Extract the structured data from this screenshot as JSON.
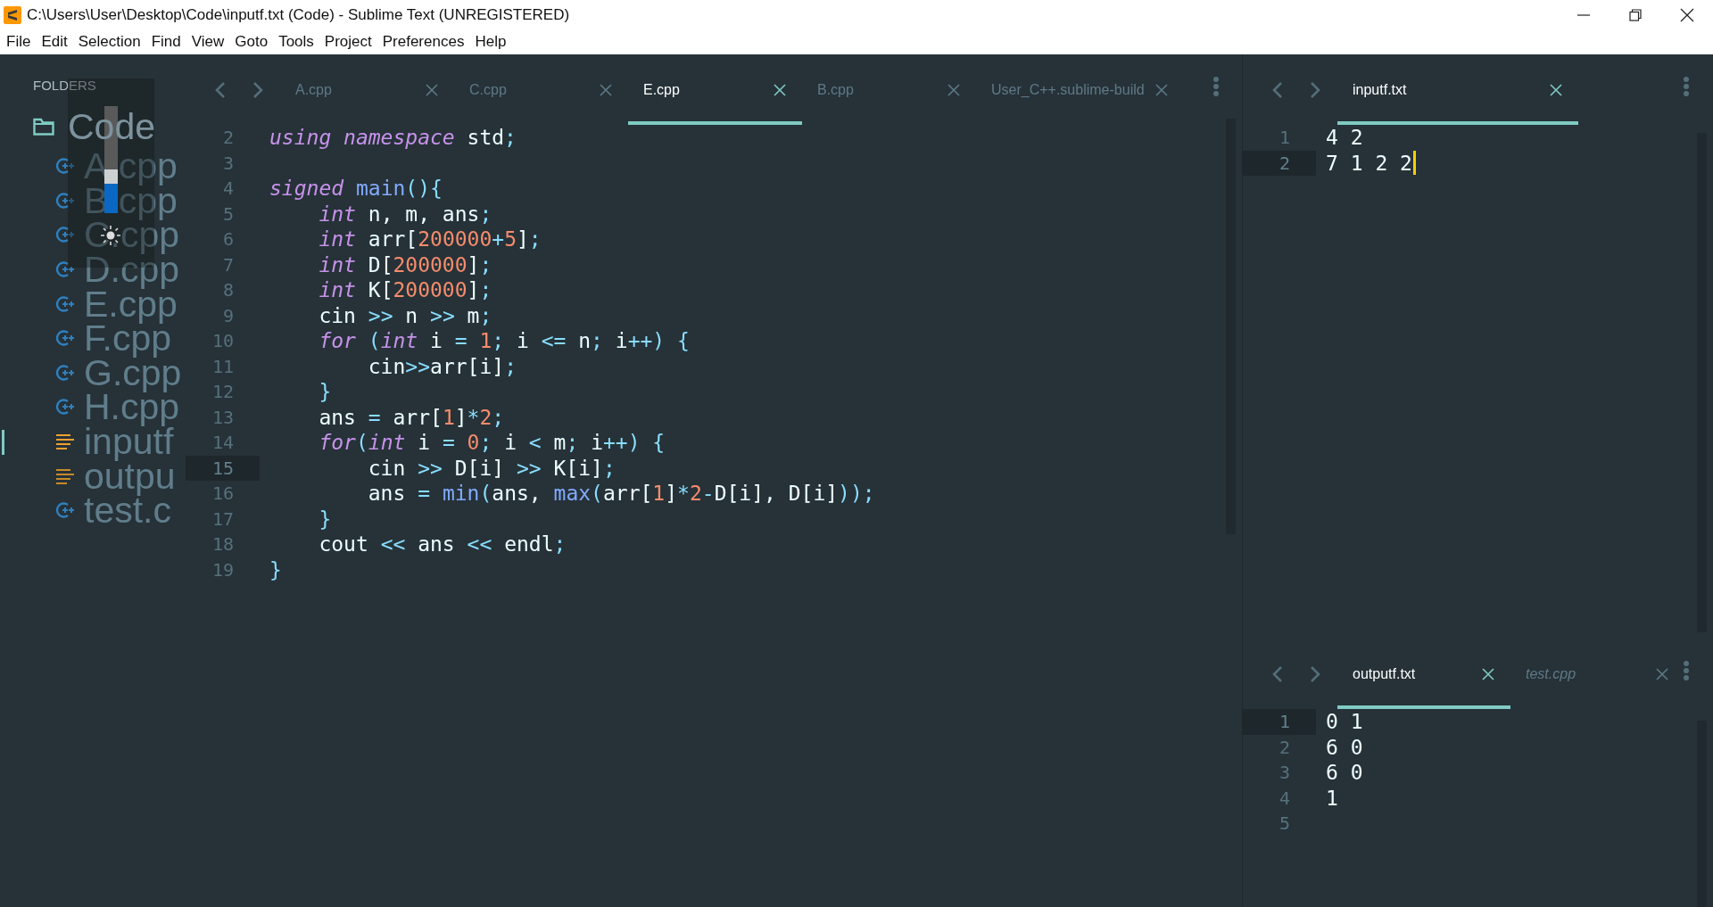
{
  "window": {
    "title": "C:\\Users\\User\\Desktop\\Code\\inputf.txt (Code) - Sublime Text (UNREGISTERED)"
  },
  "menu": [
    "File",
    "Edit",
    "Selection",
    "Find",
    "View",
    "Goto",
    "Tools",
    "Project",
    "Preferences",
    "Help"
  ],
  "sidebar": {
    "header": "FOLDERS",
    "folder": {
      "name": "Code",
      "children": [
        {
          "name": "A.cpp",
          "kind": "cpp",
          "selected": false
        },
        {
          "name": "B.cpp",
          "kind": "cpp",
          "selected": false
        },
        {
          "name": "C.cpp",
          "kind": "cpp",
          "selected": false
        },
        {
          "name": "D.cpp",
          "kind": "cpp",
          "selected": false
        },
        {
          "name": "E.cpp",
          "kind": "cpp",
          "selected": false
        },
        {
          "name": "F.cpp",
          "kind": "cpp",
          "selected": false
        },
        {
          "name": "G.cpp",
          "kind": "cpp",
          "selected": false
        },
        {
          "name": "H.cpp",
          "kind": "cpp",
          "selected": false
        },
        {
          "name": "inputf",
          "kind": "text",
          "selected": true
        },
        {
          "name": "outpu",
          "kind": "text",
          "selected": false
        },
        {
          "name": "test.c",
          "kind": "cpp",
          "selected": false
        }
      ]
    }
  },
  "brightness_popup": {
    "level": 0.34
  },
  "editor": {
    "tabs": [
      {
        "label": "A.cpp",
        "selected": false,
        "preview": false
      },
      {
        "label": "C.cpp",
        "selected": false,
        "preview": false
      },
      {
        "label": "E.cpp",
        "selected": true,
        "preview": false
      },
      {
        "label": "B.cpp",
        "selected": false,
        "preview": false
      },
      {
        "label": "User_C++.sublime-build",
        "selected": false,
        "preview": false
      }
    ],
    "lines": [
      {
        "number": "2",
        "current": false,
        "tokens": [
          {
            "kind": "kw",
            "t": "using namespace"
          },
          {
            "kind": "plain",
            "t": " std"
          },
          {
            "kind": "op",
            "t": ";"
          }
        ]
      },
      {
        "number": "3",
        "current": false
      },
      {
        "number": "4",
        "current": false,
        "tokens": [
          {
            "kind": "kw",
            "t": "signed"
          },
          {
            "kind": "fn",
            "t": " main"
          },
          {
            "kind": "op",
            "t": "(){"
          }
        ]
      },
      {
        "number": "5",
        "current": false,
        "tokens": [
          {
            "kind": "kw",
            "t": "    int"
          },
          {
            "kind": "plain",
            "t": " n, m, ans"
          },
          {
            "kind": "op",
            "t": ";"
          }
        ]
      },
      {
        "number": "6",
        "current": false,
        "tokens": [
          {
            "kind": "kw",
            "t": "    int"
          },
          {
            "kind": "plain",
            "t": " arr["
          },
          {
            "kind": "num",
            "t": "200000"
          },
          {
            "kind": "op",
            "t": "+"
          },
          {
            "kind": "num",
            "t": "5"
          },
          {
            "kind": "plain",
            "t": "]"
          },
          {
            "kind": "op",
            "t": ";"
          }
        ]
      },
      {
        "number": "7",
        "current": false,
        "tokens": [
          {
            "kind": "kw",
            "t": "    int"
          },
          {
            "kind": "plain",
            "t": " D["
          },
          {
            "kind": "num",
            "t": "200000"
          },
          {
            "kind": "plain",
            "t": "]"
          },
          {
            "kind": "op",
            "t": ";"
          }
        ]
      },
      {
        "number": "8",
        "current": false,
        "tokens": [
          {
            "kind": "kw",
            "t": "    int"
          },
          {
            "kind": "plain",
            "t": " K["
          },
          {
            "kind": "num",
            "t": "200000"
          },
          {
            "kind": "plain",
            "t": "]"
          },
          {
            "kind": "op",
            "t": ";"
          }
        ]
      },
      {
        "number": "9",
        "current": false,
        "tokens": [
          {
            "kind": "plain",
            "t": "    cin "
          },
          {
            "kind": "op",
            "t": ">>"
          },
          {
            "kind": "plain",
            "t": " n "
          },
          {
            "kind": "op",
            "t": ">>"
          },
          {
            "kind": "plain",
            "t": " m"
          },
          {
            "kind": "op",
            "t": ";"
          }
        ]
      },
      {
        "number": "10",
        "current": false,
        "tokens": [
          {
            "kind": "kw",
            "t": "    for"
          },
          {
            "kind": "op",
            "t": " ("
          },
          {
            "kind": "kw",
            "t": "int"
          },
          {
            "kind": "plain",
            "t": " i "
          },
          {
            "kind": "op",
            "t": "="
          },
          {
            "kind": "num",
            "t": " 1"
          },
          {
            "kind": "op",
            "t": ";"
          },
          {
            "kind": "plain",
            "t": " i "
          },
          {
            "kind": "op",
            "t": "<="
          },
          {
            "kind": "plain",
            "t": " n"
          },
          {
            "kind": "op",
            "t": ";"
          },
          {
            "kind": "plain",
            "t": " i"
          },
          {
            "kind": "op",
            "t": "++) {"
          }
        ]
      },
      {
        "number": "11",
        "current": false,
        "tokens": [
          {
            "kind": "plain",
            "t": "        cin"
          },
          {
            "kind": "op",
            "t": ">>"
          },
          {
            "kind": "plain",
            "t": "arr[i]"
          },
          {
            "kind": "op",
            "t": ";"
          }
        ]
      },
      {
        "number": "12",
        "current": false,
        "tokens": [
          {
            "kind": "op",
            "t": "    }"
          }
        ]
      },
      {
        "number": "13",
        "current": false,
        "tokens": [
          {
            "kind": "plain",
            "t": "    ans "
          },
          {
            "kind": "op",
            "t": "="
          },
          {
            "kind": "plain",
            "t": " arr["
          },
          {
            "kind": "num",
            "t": "1"
          },
          {
            "kind": "plain",
            "t": "]"
          },
          {
            "kind": "op",
            "t": "*"
          },
          {
            "kind": "num",
            "t": "2"
          },
          {
            "kind": "op",
            "t": ";"
          }
        ]
      },
      {
        "number": "14",
        "current": false,
        "tokens": [
          {
            "kind": "kw",
            "t": "    for"
          },
          {
            "kind": "op",
            "t": "("
          },
          {
            "kind": "kw",
            "t": "int"
          },
          {
            "kind": "plain",
            "t": " i "
          },
          {
            "kind": "op",
            "t": "="
          },
          {
            "kind": "num",
            "t": " 0"
          },
          {
            "kind": "op",
            "t": ";"
          },
          {
            "kind": "plain",
            "t": " i "
          },
          {
            "kind": "op",
            "t": "<"
          },
          {
            "kind": "plain",
            "t": " m"
          },
          {
            "kind": "op",
            "t": ";"
          },
          {
            "kind": "plain",
            "t": " i"
          },
          {
            "kind": "op",
            "t": "++) {"
          }
        ]
      },
      {
        "number": "15",
        "current": true,
        "tokens": [
          {
            "kind": "plain",
            "t": "        cin "
          },
          {
            "kind": "op",
            "t": ">>"
          },
          {
            "kind": "plain",
            "t": " D[i] "
          },
          {
            "kind": "op",
            "t": ">>"
          },
          {
            "kind": "plain",
            "t": " K[i]"
          },
          {
            "kind": "op",
            "t": ";"
          }
        ]
      },
      {
        "number": "16",
        "current": false,
        "tokens": [
          {
            "kind": "plain",
            "t": "        ans "
          },
          {
            "kind": "op",
            "t": "="
          },
          {
            "kind": "fn",
            "t": " min"
          },
          {
            "kind": "op",
            "t": "("
          },
          {
            "kind": "plain",
            "t": "ans, "
          },
          {
            "kind": "fn",
            "t": "max"
          },
          {
            "kind": "op",
            "t": "("
          },
          {
            "kind": "plain",
            "t": "arr["
          },
          {
            "kind": "num",
            "t": "1"
          },
          {
            "kind": "plain",
            "t": "]"
          },
          {
            "kind": "op",
            "t": "*"
          },
          {
            "kind": "num",
            "t": "2"
          },
          {
            "kind": "op",
            "t": "-"
          },
          {
            "kind": "plain",
            "t": "D[i], D[i]"
          },
          {
            "kind": "op",
            "t": "));"
          }
        ]
      },
      {
        "number": "17",
        "current": false,
        "tokens": [
          {
            "kind": "op",
            "t": "    }"
          }
        ]
      },
      {
        "number": "18",
        "current": false,
        "tokens": [
          {
            "kind": "plain",
            "t": "    cout "
          },
          {
            "kind": "op",
            "t": "<<"
          },
          {
            "kind": "plain",
            "t": " ans "
          },
          {
            "kind": "op",
            "t": "<<"
          },
          {
            "kind": "plain",
            "t": " endl"
          },
          {
            "kind": "op",
            "t": ";"
          }
        ]
      },
      {
        "number": "19",
        "current": false,
        "tokens": [
          {
            "kind": "op",
            "t": "}"
          }
        ]
      }
    ]
  },
  "input_pane": {
    "tabs": [
      {
        "label": "inputf.txt",
        "selected": true,
        "preview": false
      }
    ],
    "lines": [
      {
        "number": "1",
        "current": false,
        "caret": false,
        "text": "4 2"
      },
      {
        "number": "2",
        "current": true,
        "caret": true,
        "text": "7 1 2 2"
      }
    ]
  },
  "output_pane": {
    "tabs": [
      {
        "label": "outputf.txt",
        "selected": true,
        "preview": false
      },
      {
        "label": "test.cpp",
        "selected": false,
        "preview": true
      }
    ],
    "lines": [
      {
        "number": "1",
        "current": true,
        "caret": false,
        "text": "0 1"
      },
      {
        "number": "2",
        "current": false,
        "caret": false,
        "text": "6 0"
      },
      {
        "number": "3",
        "current": false,
        "caret": false,
        "text": "6 0"
      },
      {
        "number": "4",
        "current": false,
        "caret": false,
        "text": "1"
      },
      {
        "number": "5",
        "current": false,
        "caret": false
      }
    ]
  }
}
